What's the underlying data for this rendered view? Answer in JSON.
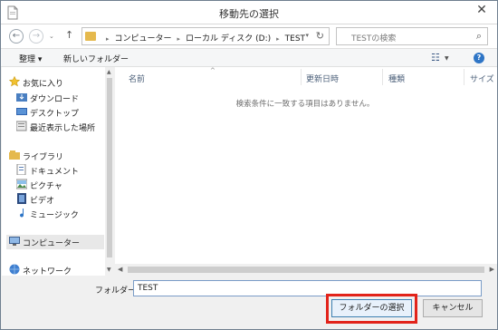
{
  "window": {
    "title": "移動先の選択",
    "close": "✕"
  },
  "nav": {
    "back": "←",
    "forward": "→",
    "down": "⌄",
    "up": "↑"
  },
  "address": {
    "crumbs": [
      "コンピューター",
      "ローカル ディスク (D:)",
      "TEST"
    ],
    "refresh": "↻"
  },
  "search": {
    "placeholder": "TESTの検索",
    "icon": "⌕"
  },
  "toolbar": {
    "organize": "整理 ▾",
    "new_folder": "新しいフォルダー",
    "help": "?"
  },
  "sidebar": {
    "items": [
      {
        "label": "お気に入り",
        "icon": "star-icon"
      },
      {
        "label": "ダウンロード",
        "icon": "download-folder-icon"
      },
      {
        "label": "デスクトップ",
        "icon": "desktop-icon"
      },
      {
        "label": "最近表示した場所",
        "icon": "recent-places-icon"
      },
      {
        "label": "ライブラリ",
        "icon": "library-icon"
      },
      {
        "label": "ドキュメント",
        "icon": "documents-icon"
      },
      {
        "label": "ピクチャ",
        "icon": "pictures-icon"
      },
      {
        "label": "ビデオ",
        "icon": "video-icon"
      },
      {
        "label": "ミュージック",
        "icon": "music-icon"
      },
      {
        "label": "コンピューター",
        "icon": "computer-icon"
      },
      {
        "label": "ネットワーク",
        "icon": "network-icon"
      }
    ]
  },
  "columns": {
    "name": "名前",
    "modified": "更新日時",
    "type": "種類",
    "size": "サイズ"
  },
  "content": {
    "empty_message": "検索条件に一致する項目はありません。"
  },
  "bottom": {
    "folder_label": "フォルダー:",
    "folder_value": "TEST",
    "select_button": "フォルダーの選択",
    "cancel_button": "キャンセル"
  },
  "colors": {
    "highlight": "#e2231a",
    "accent": "#2e75c6"
  }
}
